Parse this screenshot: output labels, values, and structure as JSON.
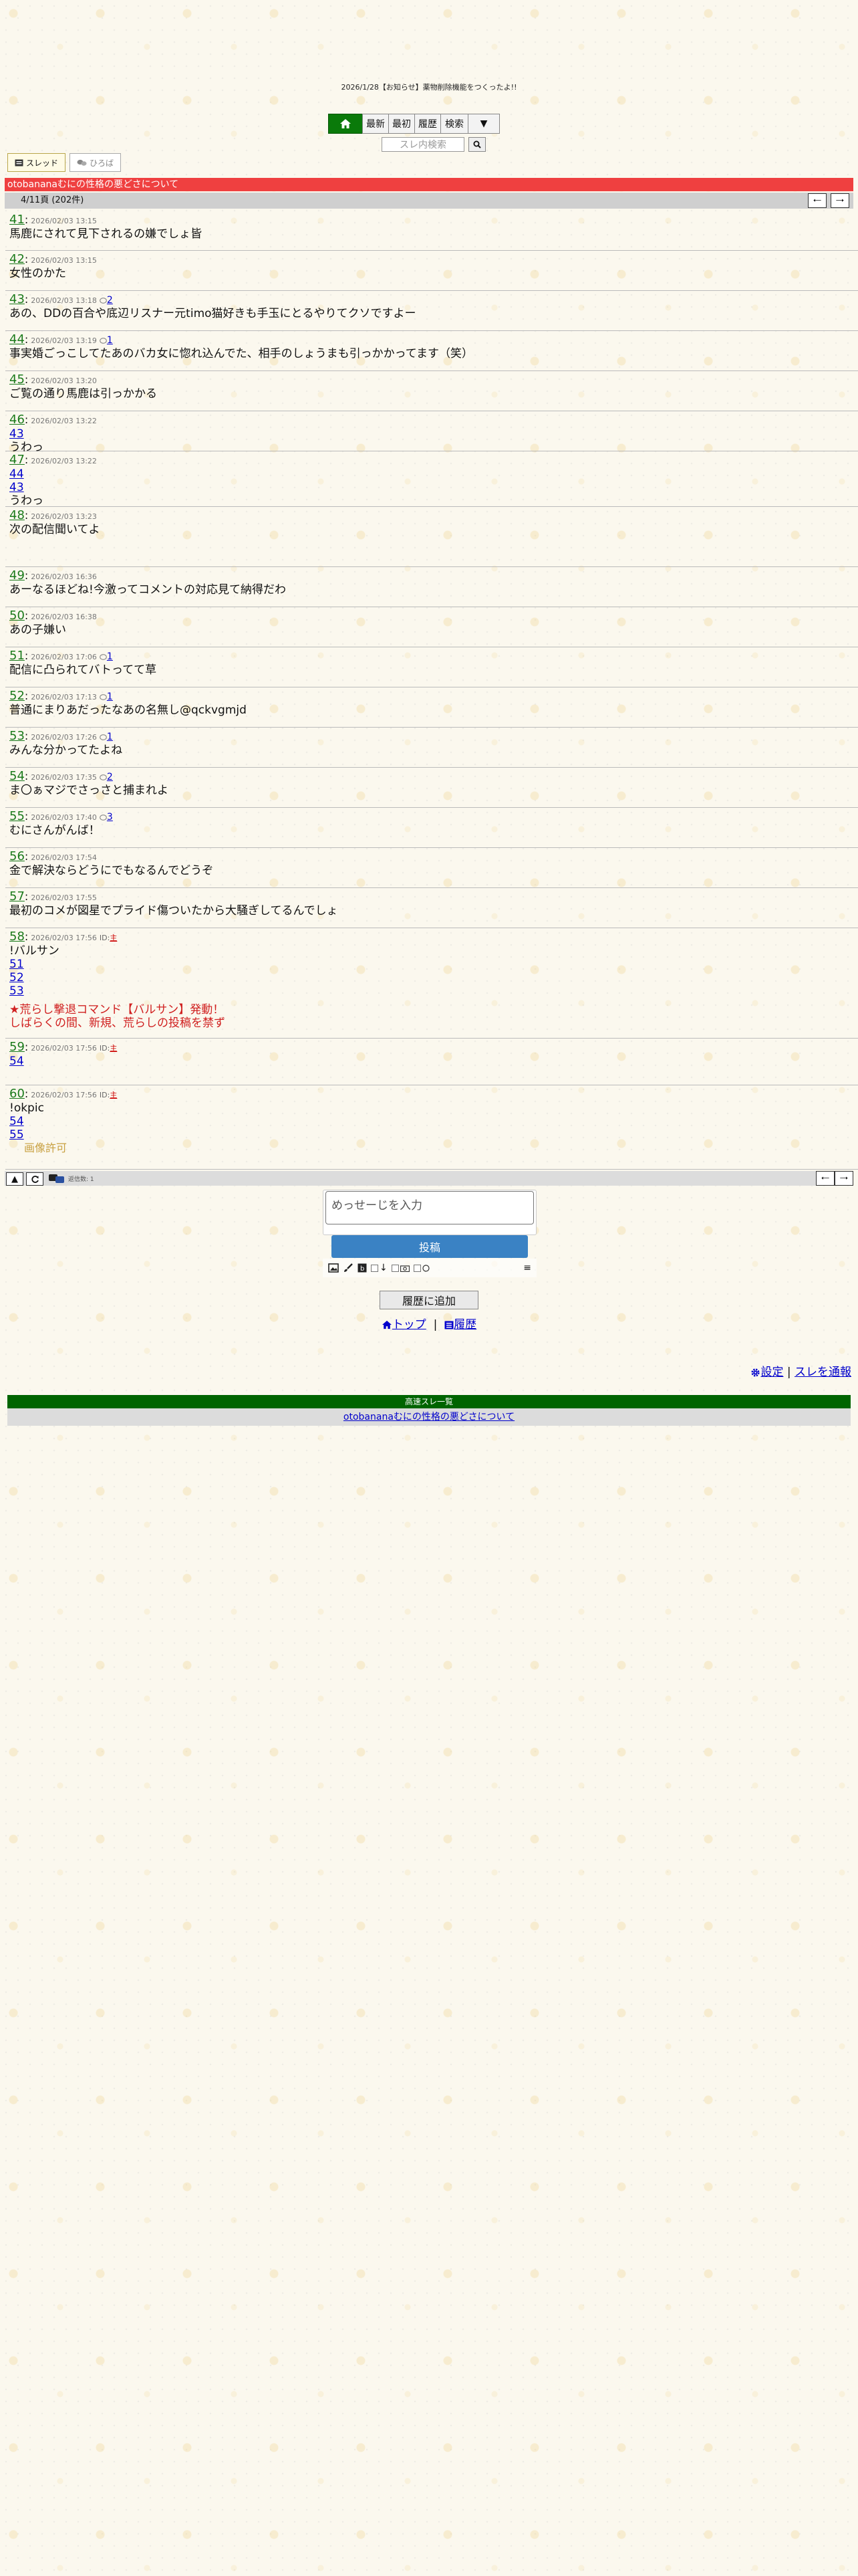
{
  "notice": "2026/1/28【お知らせ】薬物削除機能をつくったよ!!",
  "nav": {
    "home_icon": "home-icon",
    "latest": "最新",
    "first": "最初",
    "history": "履歴",
    "search": "検索",
    "more": "▼"
  },
  "search": {
    "placeholder": "スレ内検索"
  },
  "tabs": {
    "thread": "スレッド",
    "hiroba": "ひろば"
  },
  "thread_title": "otobananaむにの性格の悪どさについて",
  "page_info": "4/11頁 (202件)",
  "posts": [
    {
      "num": "41",
      "date": "2026/02/03 13:15",
      "text": "馬鹿にされて見下されるの嫌でしょ皆"
    },
    {
      "num": "42",
      "date": "2026/02/03 13:15",
      "text": "女性のかた"
    },
    {
      "num": "43",
      "date": "2026/02/03 13:18",
      "reply": "2",
      "text": "あの、DDの百合や底辺リスナー元timo猫好きも手玉にとるやりてクソですよー"
    },
    {
      "num": "44",
      "date": "2026/02/03 13:19",
      "reply": "1",
      "text": "事実婚ごっこしてたあのバカ女に惚れ込んでた、相手のしょうまも引っかかってます（笑）"
    },
    {
      "num": "45",
      "date": "2026/02/03 13:20",
      "text": "ご覧の通り馬鹿は引っかかる"
    },
    {
      "num": "46",
      "date": "2026/02/03 13:22",
      "links": [
        "43"
      ],
      "text": "うわっ"
    },
    {
      "num": "47",
      "date": "2026/02/03 13:22",
      "links": [
        "44",
        "43"
      ],
      "text": "うわっ"
    },
    {
      "num": "48",
      "date": "2026/02/03 13:23",
      "text": "次の配信聞いてよ"
    },
    {
      "num": "49",
      "date": "2026/02/03 16:36",
      "text": "あーなるほどね!今激ってコメントの対応見て納得だわ"
    },
    {
      "num": "50",
      "date": "2026/02/03 16:38",
      "text": "あの子嫌い"
    },
    {
      "num": "51",
      "date": "2026/02/03 17:06",
      "reply": "1",
      "text": "配信に凸られてバトってて草"
    },
    {
      "num": "52",
      "date": "2026/02/03 17:13",
      "reply": "1",
      "text": "普通にまりあだったなあの名無し@qckvgmjd"
    },
    {
      "num": "53",
      "date": "2026/02/03 17:26",
      "reply": "1",
      "text": "みんな分かってたよね"
    },
    {
      "num": "54",
      "date": "2026/02/03 17:35",
      "reply": "2",
      "text": "ま〇ぁマジでさっさと捕まれよ"
    },
    {
      "num": "55",
      "date": "2026/02/03 17:40",
      "reply": "3",
      "text": "むにさんがんば！"
    },
    {
      "num": "56",
      "date": "2026/02/03 17:54",
      "text": "金で解決ならどうにでもなるんでどうぞ"
    },
    {
      "num": "57",
      "date": "2026/02/03 17:55",
      "text": "最初のコメが図星でプライド傷ついたから大騒ぎしてるんでしょ"
    },
    {
      "num": "58",
      "date": "2026/02/03 17:56",
      "id": "主",
      "text": "!バルサン",
      "links_after": [
        "51",
        "52",
        "53"
      ],
      "red1": "★荒らし撃退コマンド【バルサン】発動！",
      "red2": "しばらくの間、新規、荒らしの投稿を禁ず"
    },
    {
      "num": "59",
      "date": "2026/02/03 17:56",
      "id": "主",
      "links": [
        "54"
      ]
    },
    {
      "num": "60",
      "date": "2026/02/03 17:56",
      "id": "主",
      "text": "!okpic",
      "links_after": [
        "54",
        "55"
      ],
      "gold": "画像許可"
    }
  ],
  "bottom": {
    "count_label": "返信数: 1"
  },
  "compose": {
    "placeholder": "めっせーじを入力",
    "submit": "投稿",
    "menu": "≡"
  },
  "history_add": "履歴に追加",
  "links": {
    "top": "トップ",
    "history": "履歴",
    "sep": "|"
  },
  "rlinks": {
    "settings": "設定",
    "sep": "|",
    "report": "スレを通報"
  },
  "speed": {
    "header": "高速スレ一覧",
    "item": "otobananaむにの性格の悪どさについて"
  },
  "colors": {
    "accent_green": "#0a7a0a",
    "title_red": "#ef4040",
    "post_blue": "#3a82c4"
  }
}
